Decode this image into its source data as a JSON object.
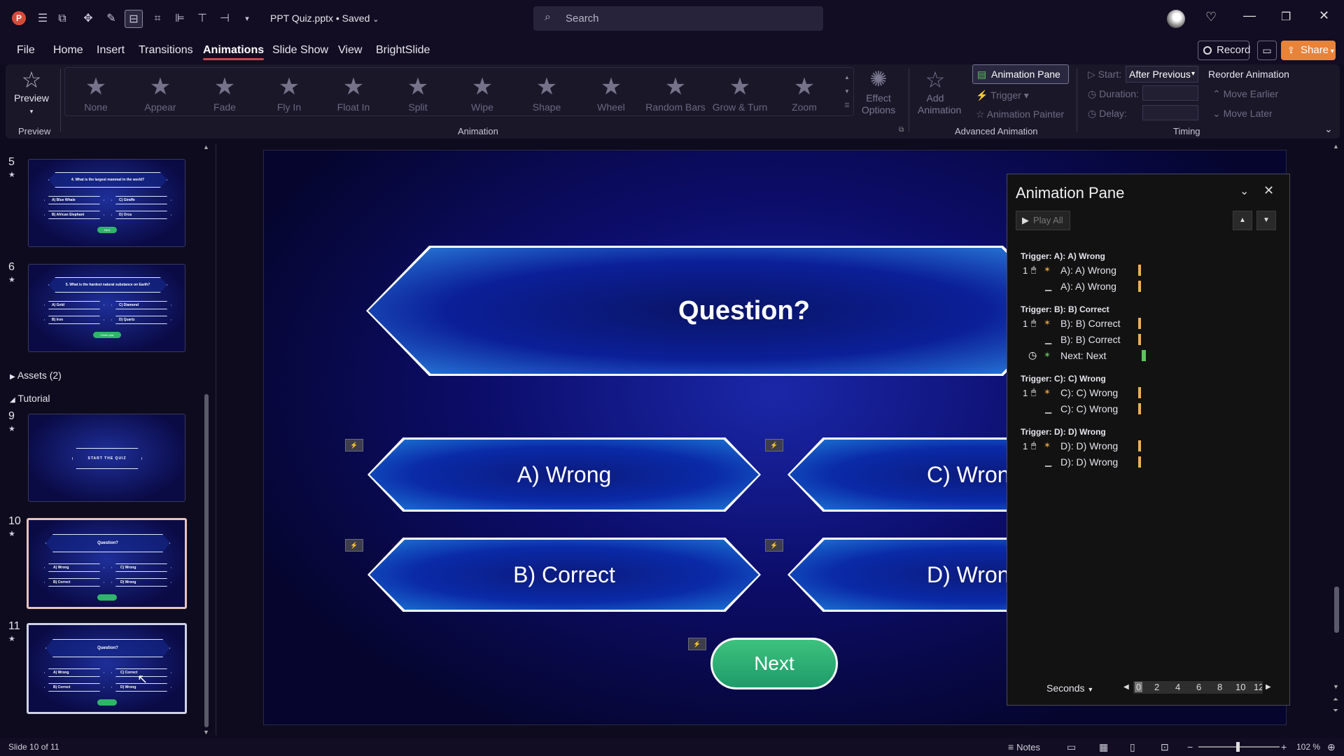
{
  "app": {
    "doc_title": "PPT Quiz.pptx • Saved",
    "search_placeholder": "Search"
  },
  "colors": {
    "accent_tab": "#c84a4a",
    "share": "#e8833a",
    "next_button": "#2eb56a",
    "anim_bar_orange": "#e8b15a",
    "anim_bar_green": "#5cc35c"
  },
  "menu": {
    "tabs": [
      "File",
      "Home",
      "Insert",
      "Transitions",
      "Animations",
      "Slide Show",
      "View",
      "BrightSlide"
    ],
    "active": "Animations",
    "record_label": "Record",
    "share_label": "Share"
  },
  "ribbon": {
    "preview_label": "Preview",
    "preview_group": "Preview",
    "gallery": [
      "None",
      "Appear",
      "Fade",
      "Fly In",
      "Float In",
      "Split",
      "Wipe",
      "Shape",
      "Wheel",
      "Random Bars",
      "Grow & Turn",
      "Zoom"
    ],
    "effect_options": "Effect Options",
    "animation_group": "Animation",
    "add_animation": "Add Animation",
    "animation_pane": "Animation Pane",
    "trigger": "Trigger",
    "animation_painter": "Animation Painter",
    "advanced_group": "Advanced Animation",
    "start_label": "Start:",
    "start_value": "After Previous",
    "duration_label": "Duration:",
    "delay_label": "Delay:",
    "timing_group": "Timing",
    "reorder_title": "Reorder Animation",
    "move_earlier": "Move Earlier",
    "move_later": "Move Later"
  },
  "slides": {
    "s5": {
      "num": "5",
      "question": "4. What is the largest mammal in the world?",
      "a": "A) Blue Whale",
      "b": "B) African Elephant",
      "c": "C) Giraffe",
      "d": "D) Orca",
      "btn": "Next"
    },
    "s6": {
      "num": "6",
      "question": "5. What is the hardest natural substance on Earth?",
      "a": "A) Gold",
      "b": "B) Iron",
      "c": "C) Diamond",
      "d": "D) Quartz",
      "btn": "Finish quiz"
    },
    "assets": "Assets (2)",
    "tutorial": "Tutorial",
    "s9": {
      "num": "9",
      "text": "START THE QUIZ"
    },
    "s10": {
      "num": "10",
      "question": "Question?",
      "a": "A) Wrong",
      "b": "B) Correct",
      "c": "C) Wrong",
      "d": "D) Wrong"
    },
    "s11": {
      "num": "11",
      "question": "Question?",
      "a": "A) Wrong",
      "b": "B) Correct",
      "c": "C) Correct",
      "d": "D) Wrong"
    }
  },
  "slide": {
    "question": "Question?",
    "a": "A) Wrong",
    "b": "B) Correct",
    "c": "C) Wron",
    "d": "D) Wron",
    "next": "Next"
  },
  "pane": {
    "title": "Animation Pane",
    "play_all": "Play All",
    "groups": [
      {
        "trigger": "Trigger: A): A) Wrong",
        "rows": [
          {
            "num": "1",
            "label": "A): A) Wrong"
          },
          {
            "num": "",
            "label": "A): A) Wrong"
          }
        ]
      },
      {
        "trigger": "Trigger: B): B) Correct",
        "rows": [
          {
            "num": "1",
            "label": "B): B) Correct"
          },
          {
            "num": "",
            "label": "B): B) Correct"
          },
          {
            "num": "",
            "label": "Next: Next"
          }
        ]
      },
      {
        "trigger": "Trigger: C): C) Wrong",
        "rows": [
          {
            "num": "1",
            "label": "C): C) Wrong"
          },
          {
            "num": "",
            "label": "C): C) Wrong"
          }
        ]
      },
      {
        "trigger": "Trigger: D): D) Wrong",
        "rows": [
          {
            "num": "1",
            "label": "D): D) Wrong"
          },
          {
            "num": "",
            "label": "D): D) Wrong"
          }
        ]
      }
    ],
    "seconds": "Seconds",
    "ticks": [
      "0",
      "2",
      "4",
      "6",
      "8",
      "10",
      "12"
    ]
  },
  "status": {
    "slide_info": "Slide 10 of 11",
    "notes": "Notes",
    "zoom": "102 %"
  }
}
